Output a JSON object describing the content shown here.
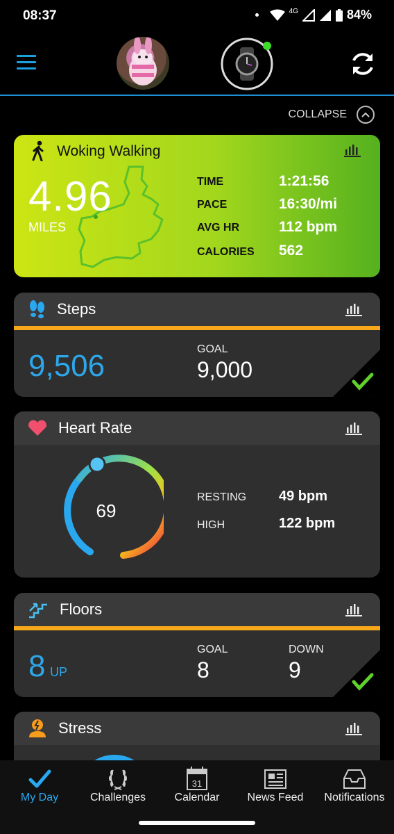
{
  "status": {
    "time": "08:37",
    "network": "4G",
    "battery": "84%"
  },
  "header": {
    "menu_icon": "hamburger-menu-icon",
    "avatar": "profile-avatar",
    "device_icon": "watch-icon",
    "sync_icon": "sync-icon",
    "accent": "#1aa1e3",
    "device_status_color": "#3ddc2a"
  },
  "collapse": {
    "label": "COLLAPSE"
  },
  "activity": {
    "title": "Woking Walking",
    "distance": "4.96",
    "unit": "MILES",
    "stats": [
      {
        "label": "TIME",
        "value": "1:21:56"
      },
      {
        "label": "PACE",
        "value": "16:30/mi"
      },
      {
        "label": "AVG HR",
        "value": "112 bpm"
      },
      {
        "label": "CALORIES",
        "value": "562"
      }
    ]
  },
  "steps": {
    "title": "Steps",
    "value": "9,506",
    "goal_label": "GOAL",
    "goal": "9,000",
    "progress": 1.0
  },
  "heart_rate": {
    "title": "Heart Rate",
    "current": "69",
    "resting_label": "RESTING",
    "resting": "49 bpm",
    "high_label": "HIGH",
    "high": "122 bpm"
  },
  "floors": {
    "title": "Floors",
    "up": "8",
    "up_label": "UP",
    "goal_label": "GOAL",
    "goal": "8",
    "down_label": "DOWN",
    "down": "9",
    "progress": 1.0
  },
  "stress": {
    "title": "Stress"
  },
  "nav": [
    {
      "label": "My Day",
      "icon": "check-icon",
      "active": true
    },
    {
      "label": "Challenges",
      "icon": "laurel-icon",
      "active": false
    },
    {
      "label": "Calendar",
      "icon": "calendar-icon",
      "calendar_day": "31",
      "active": false
    },
    {
      "label": "News Feed",
      "icon": "newspaper-icon",
      "active": false
    },
    {
      "label": "Notifications",
      "icon": "inbox-icon",
      "active": false
    }
  ],
  "colors": {
    "active_nav": "#2aa8ef",
    "progress_bar": "#f8a91a",
    "goal_check": "#5fd12b"
  }
}
